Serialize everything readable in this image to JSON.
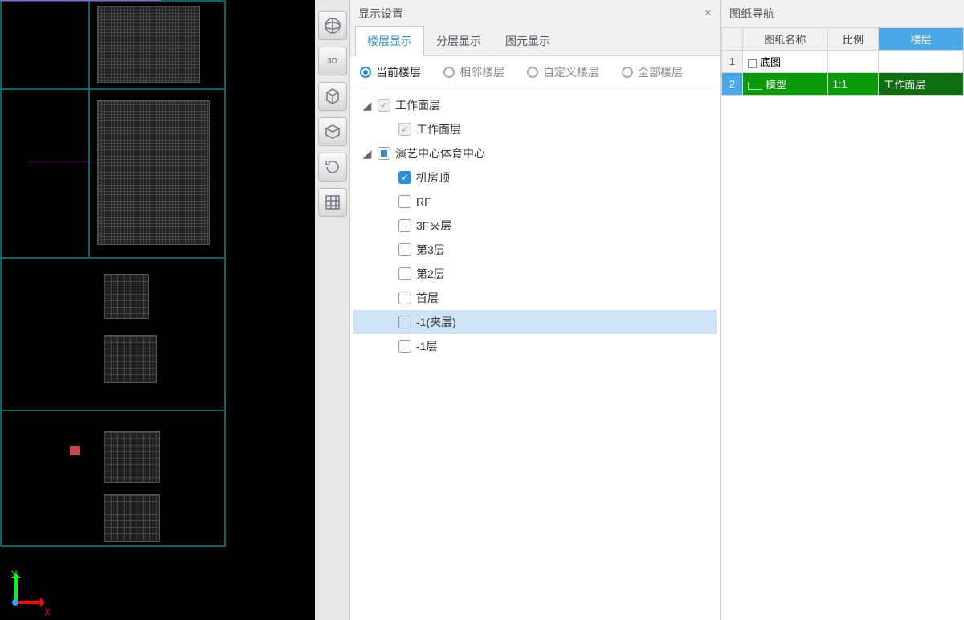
{
  "axis": {
    "y": "Y",
    "x": "X"
  },
  "toolbar": {
    "globe_name": "globe-3d-icon",
    "label_3d": "3D",
    "cube_front_name": "cube-front-icon",
    "cube_iso_name": "cube-iso-icon",
    "rotate_name": "rotate-icon",
    "grid_name": "grid-panel-icon"
  },
  "settings": {
    "title": "显示设置",
    "tabs": [
      "楼层显示",
      "分层显示",
      "图元显示"
    ],
    "active_tab": 0,
    "radios": [
      "当前楼层",
      "相邻楼层",
      "自定义楼层",
      "全部楼层"
    ],
    "radio_checked": 0,
    "tree": [
      {
        "depth": 0,
        "twist": "◢",
        "cb": "dim",
        "label": "工作面层"
      },
      {
        "depth": 1,
        "twist": "",
        "cb": "dim",
        "label": "工作面层"
      },
      {
        "depth": 0,
        "twist": "◢",
        "cb": "tri",
        "label": "演艺中心体育中心"
      },
      {
        "depth": 1,
        "twist": "",
        "cb": "chk",
        "label": "机房顶"
      },
      {
        "depth": 1,
        "twist": "",
        "cb": "off",
        "label": "RF"
      },
      {
        "depth": 1,
        "twist": "",
        "cb": "off",
        "label": "3F夹层"
      },
      {
        "depth": 1,
        "twist": "",
        "cb": "off",
        "label": "第3层"
      },
      {
        "depth": 1,
        "twist": "",
        "cb": "off",
        "label": "第2层"
      },
      {
        "depth": 1,
        "twist": "",
        "cb": "off",
        "label": "首层"
      },
      {
        "depth": 1,
        "twist": "",
        "cb": "off",
        "label": "-1(夹层)",
        "sel": true
      },
      {
        "depth": 1,
        "twist": "",
        "cb": "off",
        "label": "-1层"
      }
    ]
  },
  "nav": {
    "title": "图纸导航",
    "cols": [
      "图纸名称",
      "比例",
      "楼层"
    ],
    "sorted_col": 2,
    "rows": [
      {
        "n": "1",
        "name": "底图",
        "scale": "",
        "floor": "",
        "expand": "-"
      },
      {
        "n": "2",
        "name": "模型",
        "scale": "1:1",
        "floor": "工作面层",
        "hl": true,
        "child": true
      }
    ]
  }
}
